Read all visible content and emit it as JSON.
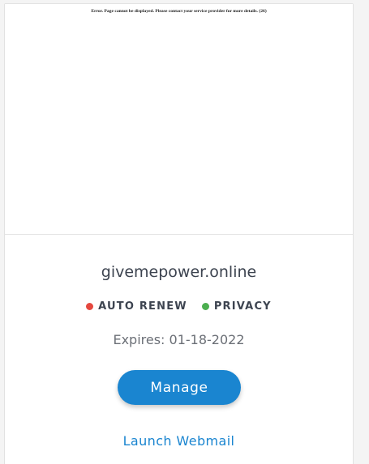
{
  "preview": {
    "error_message": "Error. Page cannot be displayed. Please contact your service provider for more details. (26)"
  },
  "domain": {
    "name": "givemepower.online"
  },
  "badges": [
    {
      "label": "AUTO RENEW",
      "color": "#e5483f",
      "icon": "status-dot-red"
    },
    {
      "label": "PRIVACY",
      "color": "#4caf50",
      "icon": "status-dot-green"
    }
  ],
  "expires": {
    "text": "Expires: 01-18-2022"
  },
  "actions": {
    "manage_label": "Manage",
    "webmail_label": "Launch Webmail"
  },
  "colors": {
    "accent": "#1a85d0",
    "text": "#3d4450"
  }
}
